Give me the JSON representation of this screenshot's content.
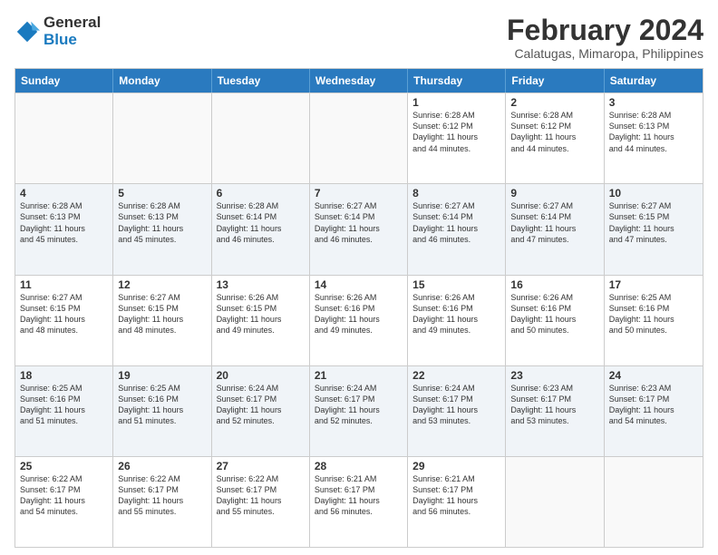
{
  "logo": {
    "line1": "General",
    "line2": "Blue"
  },
  "title": "February 2024",
  "subtitle": "Calatugas, Mimaropa, Philippines",
  "days_header": [
    "Sunday",
    "Monday",
    "Tuesday",
    "Wednesday",
    "Thursday",
    "Friday",
    "Saturday"
  ],
  "weeks": [
    [
      {
        "day": "",
        "info": ""
      },
      {
        "day": "",
        "info": ""
      },
      {
        "day": "",
        "info": ""
      },
      {
        "day": "",
        "info": ""
      },
      {
        "day": "1",
        "info": "Sunrise: 6:28 AM\nSunset: 6:12 PM\nDaylight: 11 hours\nand 44 minutes."
      },
      {
        "day": "2",
        "info": "Sunrise: 6:28 AM\nSunset: 6:12 PM\nDaylight: 11 hours\nand 44 minutes."
      },
      {
        "day": "3",
        "info": "Sunrise: 6:28 AM\nSunset: 6:13 PM\nDaylight: 11 hours\nand 44 minutes."
      }
    ],
    [
      {
        "day": "4",
        "info": "Sunrise: 6:28 AM\nSunset: 6:13 PM\nDaylight: 11 hours\nand 45 minutes."
      },
      {
        "day": "5",
        "info": "Sunrise: 6:28 AM\nSunset: 6:13 PM\nDaylight: 11 hours\nand 45 minutes."
      },
      {
        "day": "6",
        "info": "Sunrise: 6:28 AM\nSunset: 6:14 PM\nDaylight: 11 hours\nand 46 minutes."
      },
      {
        "day": "7",
        "info": "Sunrise: 6:27 AM\nSunset: 6:14 PM\nDaylight: 11 hours\nand 46 minutes."
      },
      {
        "day": "8",
        "info": "Sunrise: 6:27 AM\nSunset: 6:14 PM\nDaylight: 11 hours\nand 46 minutes."
      },
      {
        "day": "9",
        "info": "Sunrise: 6:27 AM\nSunset: 6:14 PM\nDaylight: 11 hours\nand 47 minutes."
      },
      {
        "day": "10",
        "info": "Sunrise: 6:27 AM\nSunset: 6:15 PM\nDaylight: 11 hours\nand 47 minutes."
      }
    ],
    [
      {
        "day": "11",
        "info": "Sunrise: 6:27 AM\nSunset: 6:15 PM\nDaylight: 11 hours\nand 48 minutes."
      },
      {
        "day": "12",
        "info": "Sunrise: 6:27 AM\nSunset: 6:15 PM\nDaylight: 11 hours\nand 48 minutes."
      },
      {
        "day": "13",
        "info": "Sunrise: 6:26 AM\nSunset: 6:15 PM\nDaylight: 11 hours\nand 49 minutes."
      },
      {
        "day": "14",
        "info": "Sunrise: 6:26 AM\nSunset: 6:16 PM\nDaylight: 11 hours\nand 49 minutes."
      },
      {
        "day": "15",
        "info": "Sunrise: 6:26 AM\nSunset: 6:16 PM\nDaylight: 11 hours\nand 49 minutes."
      },
      {
        "day": "16",
        "info": "Sunrise: 6:26 AM\nSunset: 6:16 PM\nDaylight: 11 hours\nand 50 minutes."
      },
      {
        "day": "17",
        "info": "Sunrise: 6:25 AM\nSunset: 6:16 PM\nDaylight: 11 hours\nand 50 minutes."
      }
    ],
    [
      {
        "day": "18",
        "info": "Sunrise: 6:25 AM\nSunset: 6:16 PM\nDaylight: 11 hours\nand 51 minutes."
      },
      {
        "day": "19",
        "info": "Sunrise: 6:25 AM\nSunset: 6:16 PM\nDaylight: 11 hours\nand 51 minutes."
      },
      {
        "day": "20",
        "info": "Sunrise: 6:24 AM\nSunset: 6:17 PM\nDaylight: 11 hours\nand 52 minutes."
      },
      {
        "day": "21",
        "info": "Sunrise: 6:24 AM\nSunset: 6:17 PM\nDaylight: 11 hours\nand 52 minutes."
      },
      {
        "day": "22",
        "info": "Sunrise: 6:24 AM\nSunset: 6:17 PM\nDaylight: 11 hours\nand 53 minutes."
      },
      {
        "day": "23",
        "info": "Sunrise: 6:23 AM\nSunset: 6:17 PM\nDaylight: 11 hours\nand 53 minutes."
      },
      {
        "day": "24",
        "info": "Sunrise: 6:23 AM\nSunset: 6:17 PM\nDaylight: 11 hours\nand 54 minutes."
      }
    ],
    [
      {
        "day": "25",
        "info": "Sunrise: 6:22 AM\nSunset: 6:17 PM\nDaylight: 11 hours\nand 54 minutes."
      },
      {
        "day": "26",
        "info": "Sunrise: 6:22 AM\nSunset: 6:17 PM\nDaylight: 11 hours\nand 55 minutes."
      },
      {
        "day": "27",
        "info": "Sunrise: 6:22 AM\nSunset: 6:17 PM\nDaylight: 11 hours\nand 55 minutes."
      },
      {
        "day": "28",
        "info": "Sunrise: 6:21 AM\nSunset: 6:17 PM\nDaylight: 11 hours\nand 56 minutes."
      },
      {
        "day": "29",
        "info": "Sunrise: 6:21 AM\nSunset: 6:17 PM\nDaylight: 11 hours\nand 56 minutes."
      },
      {
        "day": "",
        "info": ""
      },
      {
        "day": "",
        "info": ""
      }
    ]
  ]
}
